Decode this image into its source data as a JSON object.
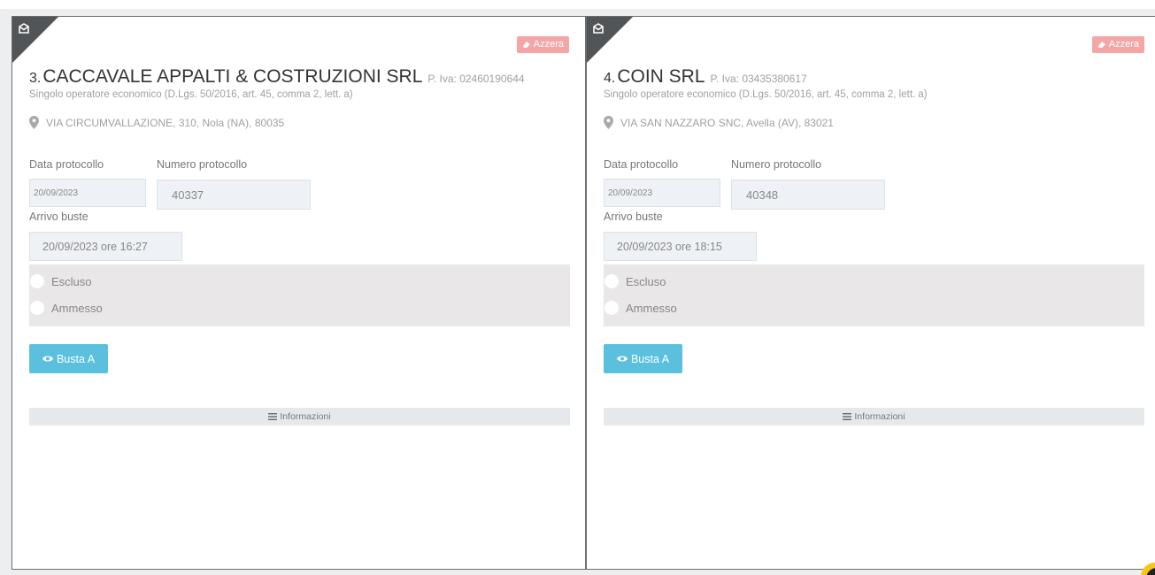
{
  "cards": [
    {
      "reset_label": "Azzera",
      "number": "3.",
      "name": "CACCAVALE APPALTI & COSTRUZIONI SRL",
      "piva": "P. Iva: 02460190644",
      "subtitle": "Singolo operatore economico (D.Lgs. 50/2016, art. 45, comma 2, lett. a)",
      "address": "VIA CIRCUMVALLAZIONE, 310, Nola (NA), 80035",
      "data_protocollo_label": "Data protocollo",
      "numero_protocollo_label": "Numero protocollo",
      "data_protocollo_value": "20/09/2023",
      "numero_protocollo_value": "40337",
      "arrivo_buste_label": "Arrivo buste",
      "arrivo_buste_value": "20/09/2023 ore 16:27",
      "radio_escluso": "Escluso",
      "radio_ammesso": "Ammesso",
      "busta_label": "Busta A",
      "info_label": "Informazioni"
    },
    {
      "reset_label": "Azzera",
      "number": "4.",
      "name": "COIN SRL",
      "piva": "P. Iva: 03435380617",
      "subtitle": "Singolo operatore economico (D.Lgs. 50/2016, art. 45, comma 2, lett. a)",
      "address": "VIA SAN NAZZARO SNC, Avella (AV), 83021",
      "data_protocollo_label": "Data protocollo",
      "numero_protocollo_label": "Numero protocollo",
      "data_protocollo_value": "20/09/2023",
      "numero_protocollo_value": "40348",
      "arrivo_buste_label": "Arrivo buste",
      "arrivo_buste_value": "20/09/2023 ore 18:15",
      "radio_escluso": "Escluso",
      "radio_ammesso": "Ammesso",
      "busta_label": "Busta A",
      "info_label": "Informazioni"
    }
  ],
  "icons": {
    "corner": "envelope-icon",
    "reset": "eraser-icon",
    "address": "map-pin-icon",
    "busta": "eye-icon",
    "info": "menu-icon"
  },
  "colors": {
    "reset_button": "#f4a6a6",
    "busta_button": "#5bc0de",
    "corner_triangle": "#515558",
    "radio_panel": "#e9e7e8",
    "field_bg": "#eef1f5"
  }
}
